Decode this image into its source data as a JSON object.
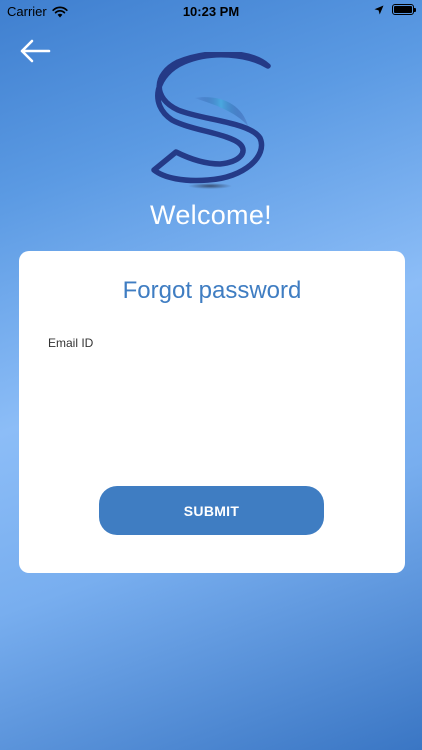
{
  "status_bar": {
    "carrier": "Carrier",
    "time": "10:23 PM",
    "icons": [
      "wifi-icon",
      "location-arrow-icon",
      "battery-icon"
    ]
  },
  "nav": {
    "back_icon": "arrow-left-icon"
  },
  "logo": {
    "icon": "s-logo-icon"
  },
  "header": {
    "welcome": "Welcome!"
  },
  "form": {
    "title": "Forgot password",
    "email_label": "Email ID",
    "email_value": "",
    "email_placeholder": "",
    "submit_label": "SUBMIT"
  },
  "colors": {
    "accent": "#3f7dc2",
    "logo_dark": "#243a87",
    "logo_light": "#4aa8e0",
    "card_bg": "#ffffff"
  }
}
